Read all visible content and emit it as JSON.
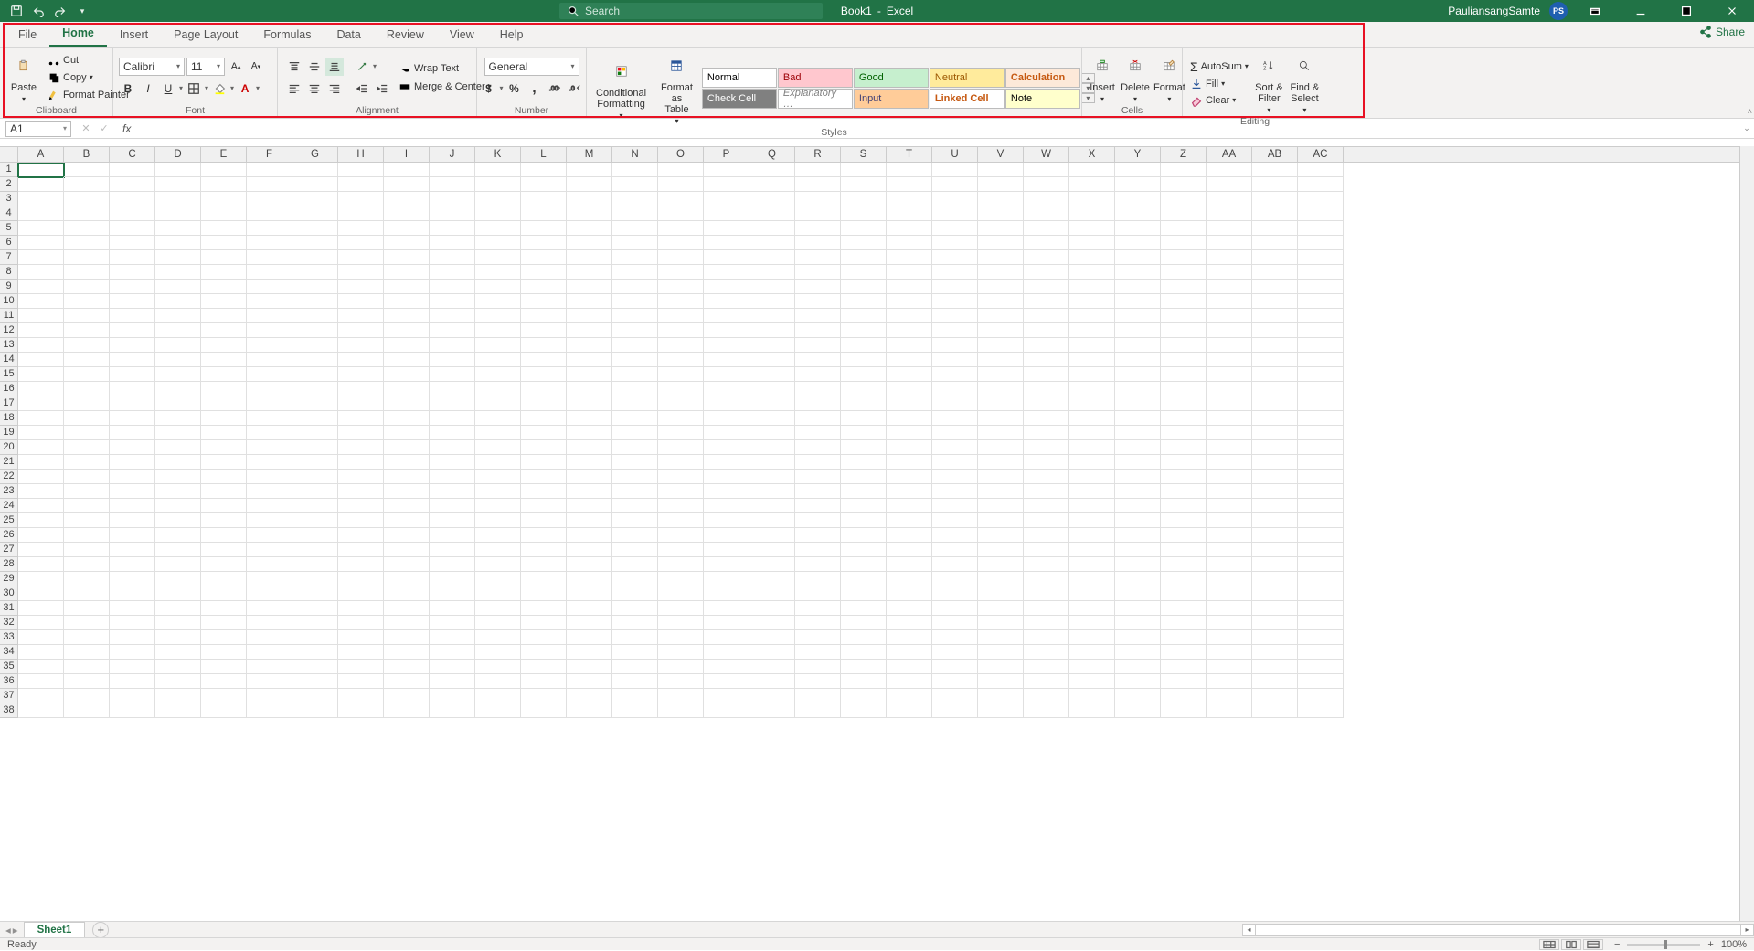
{
  "titlebar": {
    "doc_name": "Book1",
    "app_name": "Excel",
    "search_placeholder": "Search",
    "user_name": "PauliansangSamte",
    "user_initials": "PS"
  },
  "tabs": [
    "File",
    "Home",
    "Insert",
    "Page Layout",
    "Formulas",
    "Data",
    "Review",
    "View",
    "Help"
  ],
  "active_tab": "Home",
  "share_label": "Share",
  "ribbon": {
    "clipboard": {
      "paste": "Paste",
      "cut": "Cut",
      "copy": "Copy",
      "format_painter": "Format Painter",
      "label": "Clipboard"
    },
    "font": {
      "name": "Calibri",
      "size": "11",
      "label": "Font"
    },
    "alignment": {
      "wrap": "Wrap Text",
      "merge": "Merge & Center",
      "label": "Alignment"
    },
    "number": {
      "format": "General",
      "label": "Number"
    },
    "styles": {
      "cond_fmt": "Conditional Formatting",
      "fmt_table": "Format as Table",
      "gallery": [
        {
          "label": "Normal",
          "bg": "#ffffff",
          "fg": "#000"
        },
        {
          "label": "Bad",
          "bg": "#ffc7ce",
          "fg": "#9c0006"
        },
        {
          "label": "Good",
          "bg": "#c6efce",
          "fg": "#006100"
        },
        {
          "label": "Neutral",
          "bg": "#ffeb9c",
          "fg": "#9c5700"
        },
        {
          "label": "Calculation",
          "bg": "#fde9d9",
          "fg": "#c65911"
        },
        {
          "label": "Check Cell",
          "bg": "#808080",
          "fg": "#ffffff"
        },
        {
          "label": "Explanatory …",
          "bg": "#ffffff",
          "fg": "#7f7f7f"
        },
        {
          "label": "Input",
          "bg": "#ffcc99",
          "fg": "#3f3f76"
        },
        {
          "label": "Linked Cell",
          "bg": "#ffffff",
          "fg": "#c65911"
        },
        {
          "label": "Note",
          "bg": "#ffffcc",
          "fg": "#000"
        }
      ],
      "label": "Styles"
    },
    "cells": {
      "insert": "Insert",
      "delete": "Delete",
      "format": "Format",
      "label": "Cells"
    },
    "editing": {
      "autosum": "AutoSum",
      "fill": "Fill",
      "clear": "Clear",
      "sort": "Sort & Filter",
      "find": "Find & Select",
      "label": "Editing"
    }
  },
  "namebox": "A1",
  "columns": [
    "A",
    "B",
    "C",
    "D",
    "E",
    "F",
    "G",
    "H",
    "I",
    "J",
    "K",
    "L",
    "M",
    "N",
    "O",
    "P",
    "Q",
    "R",
    "S",
    "T",
    "U",
    "V",
    "W",
    "X",
    "Y",
    "Z",
    "AA",
    "AB",
    "AC"
  ],
  "row_count": 38,
  "sheet_tabs": [
    "Sheet1"
  ],
  "status": {
    "ready": "Ready",
    "zoom": "100%"
  }
}
